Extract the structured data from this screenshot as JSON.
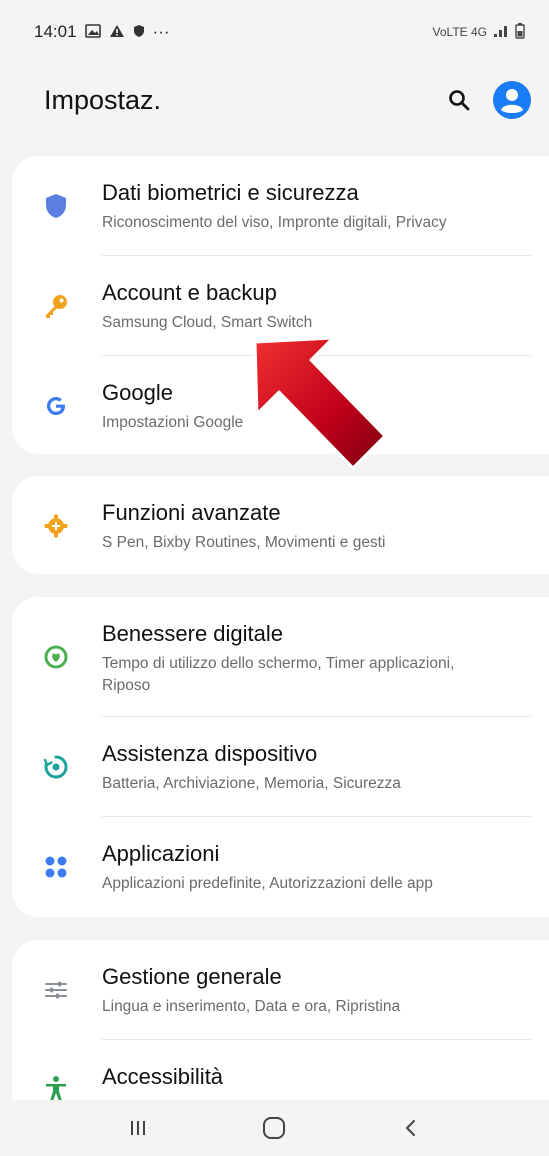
{
  "status_bar": {
    "time": "14:01",
    "indicators": [
      "gallery-icon",
      "warning-icon",
      "shield-icon"
    ],
    "more": "···",
    "right_text": "VoLTE 4G"
  },
  "header": {
    "title": "Impostaz.",
    "search_icon": "search-icon",
    "account_icon": "account-icon",
    "colors": {
      "account": "#1a7cf5"
    }
  },
  "groups": [
    {
      "items": [
        {
          "title": "Dati biometrici e sicurezza",
          "subtitle": "Riconoscimento del viso, Impronte digitali, Privacy",
          "icon": "shield-icon",
          "color": "#5b7fe0"
        },
        {
          "title": "Account e backup",
          "subtitle": "Samsung Cloud, Smart Switch",
          "icon": "key-icon",
          "color": "#f3a21c"
        },
        {
          "title": "Google",
          "subtitle": "Impostazioni Google",
          "icon": "google-icon",
          "color": "#3d7cf0"
        }
      ]
    },
    {
      "items": [
        {
          "title": "Funzioni avanzate",
          "subtitle": "S Pen, Bixby Routines, Movimenti e gesti",
          "icon": "gear-plus-icon",
          "color": "#f3a21c"
        }
      ]
    },
    {
      "items": [
        {
          "title": "Benessere digitale",
          "subtitle": "Tempo di utilizzo dello schermo, Timer applicazioni, Riposo",
          "icon": "wellbeing-icon",
          "color": "#4caf50"
        },
        {
          "title": "Assistenza dispositivo",
          "subtitle": "Batteria, Archiviazione, Memoria, Sicurezza",
          "icon": "device-care-icon",
          "color": "#1aa39a"
        },
        {
          "title": "Applicazioni",
          "subtitle": "Applicazioni predefinite, Autorizzazioni delle app",
          "icon": "apps-icon",
          "color": "#3d7cf0"
        }
      ]
    },
    {
      "items": [
        {
          "title": "Gestione generale",
          "subtitle": "Lingua e inserimento, Data e ora, Ripristina",
          "icon": "sliders-icon",
          "color": "#8a8f96"
        },
        {
          "title": "Accessibilità",
          "subtitle": "",
          "icon": "accessibility-icon",
          "color": "#2e9e4f"
        }
      ]
    }
  ],
  "nav_bar": {
    "recents_icon": "recents-icon",
    "home_icon": "home-icon",
    "back_icon": "back-icon"
  },
  "annotation": {
    "arrow_color": "#c0001a",
    "points_to": "Account e backup"
  }
}
